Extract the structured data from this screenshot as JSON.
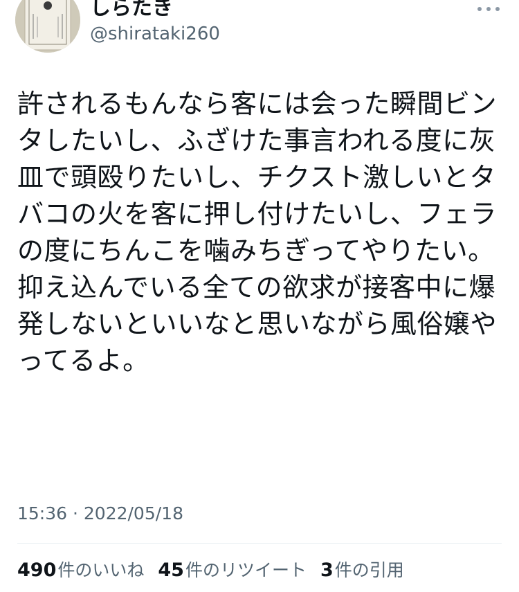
{
  "user": {
    "display_name": "しらたき",
    "handle": "@shirataki260",
    "avatar_text": "しらたき",
    "avatar_icon": "shirataki-package-avatar"
  },
  "more_icon": "more-horizontal-icon",
  "tweet": {
    "text": "許されるもんなら客には会った瞬間ビンタしたいし、ふざけた事言われる度に灰皿で頭殴りたいし、チクスト激しいとタバコの火を客に押し付けたいし、フェラの度にちんこを噛みちぎってやりたい。\n抑え込んでいる全ての欲求が接客中に爆発しないといいなと思いながら風俗嬢やってるよ。",
    "timestamp": "15:36 · 2022/05/18"
  },
  "stats": {
    "likes": {
      "count": "490",
      "label": "件のいいね"
    },
    "retweets": {
      "count": "45",
      "label": "件のリツイート"
    },
    "quotes": {
      "count": "3",
      "label": "件の引用"
    }
  },
  "colors": {
    "text_primary": "#0f1419",
    "text_secondary": "#536471",
    "divider": "#e6ecf0"
  }
}
